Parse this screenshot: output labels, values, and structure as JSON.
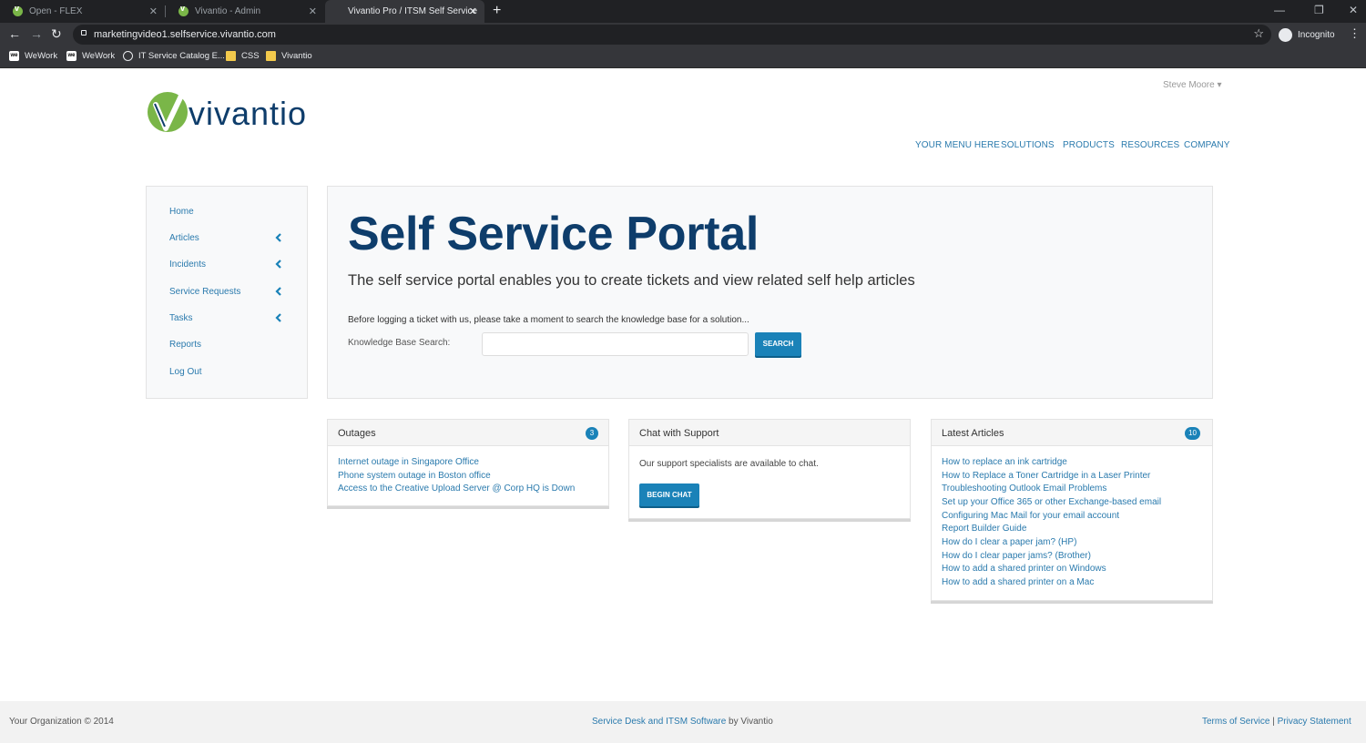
{
  "browser": {
    "tabs": [
      {
        "title": "Open - FLEX",
        "active": false
      },
      {
        "title": "Vivantio - Admin",
        "active": false
      },
      {
        "title": "Vivantio Pro / ITSM Self Service",
        "active": true
      }
    ],
    "url": "marketingvideo1.selfservice.vivantio.com",
    "profile_label": "Incognito",
    "bookmarks": [
      {
        "label": "WeWork",
        "icon": "wework-icon"
      },
      {
        "label": "WeWork",
        "icon": "wework-icon"
      },
      {
        "label": "IT Service Catalog E...",
        "icon": "globe-icon"
      },
      {
        "label": "CSS",
        "icon": "folder-icon"
      },
      {
        "label": "Vivantio",
        "icon": "folder-icon"
      }
    ]
  },
  "header": {
    "logo_text": "vivantio",
    "user_name": "Steve Moore",
    "nav": [
      "YOUR MENU HERE",
      "SOLUTIONS",
      "PRODUCTS",
      "RESOURCES",
      "COMPANY"
    ]
  },
  "sidebar": {
    "items": [
      {
        "label": "Home",
        "expandable": false
      },
      {
        "label": "Articles",
        "expandable": true
      },
      {
        "label": "Incidents",
        "expandable": true
      },
      {
        "label": "Service Requests",
        "expandable": true
      },
      {
        "label": "Tasks",
        "expandable": true
      },
      {
        "label": "Reports",
        "expandable": false
      },
      {
        "label": "Log Out",
        "expandable": false
      }
    ]
  },
  "hero": {
    "title": "Self Service Portal",
    "subtitle": "The self service portal enables you to create tickets and view related self help articles",
    "note": "Before logging a ticket with us, please take a moment to search the knowledge base for a solution...",
    "search_label": "Knowledge Base Search:",
    "search_value": "",
    "search_button": "SEARCH"
  },
  "outages": {
    "title": "Outages",
    "count": "3",
    "items": [
      "Internet outage in Singapore Office",
      "Phone system outage in Boston office",
      "Access to the Creative Upload Server @ Corp HQ is Down"
    ]
  },
  "chat": {
    "title": "Chat with Support",
    "text": "Our support specialists are available to chat.",
    "button": "BEGIN CHAT"
  },
  "articles": {
    "title": "Latest Articles",
    "count": "10",
    "items": [
      "How to replace an ink cartridge",
      "How to Replace a Toner Cartridge in a Laser Printer",
      "Troubleshooting Outlook Email Problems",
      "Set up your Office 365 or other Exchange-based email",
      "Configuring Mac Mail for your email account",
      "Report Builder Guide",
      "How do I clear a paper jam? (HP)",
      "How do I clear paper jams? (Brother)",
      "How to add a shared printer on Windows",
      "How to add a shared printer on a Mac"
    ]
  },
  "footer": {
    "copyright": "Your Organization © 2014",
    "mid_link": "Service Desk and ITSM Software",
    "mid_suffix": " by Vivantio",
    "terms": "Terms of Service",
    "separator": " | ",
    "privacy": "Privacy Statement"
  },
  "colors": {
    "brand_navy": "#0e3d6b",
    "link_blue": "#2a7aad",
    "button_blue": "#1a82b8",
    "logo_green": "#7ab648"
  }
}
